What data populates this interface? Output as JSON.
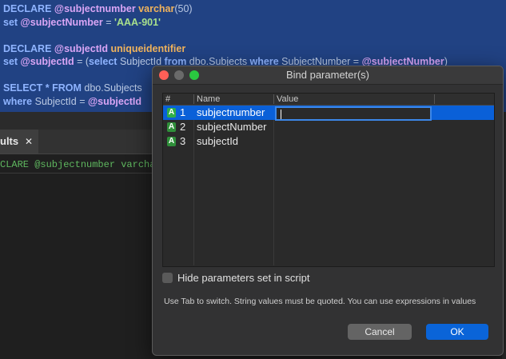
{
  "editor": {
    "lines": [
      {
        "parts": [
          [
            "DECLARE ",
            "kw"
          ],
          [
            "@subjectnumber ",
            "var"
          ],
          [
            "varchar",
            "type"
          ],
          [
            "(50)",
            "plain"
          ]
        ]
      },
      {
        "parts": [
          [
            "set ",
            "kw"
          ],
          [
            "@subjectNumber ",
            "var"
          ],
          [
            "= ",
            "plain"
          ],
          [
            "'AAA-901'",
            "str"
          ]
        ]
      },
      {
        "parts": []
      },
      {
        "parts": [
          [
            "DECLARE ",
            "kw"
          ],
          [
            "@subjectId ",
            "var"
          ],
          [
            "uniqueidentifier",
            "type"
          ]
        ]
      },
      {
        "parts": [
          [
            "set ",
            "kw"
          ],
          [
            "@subjectId ",
            "var"
          ],
          [
            "= (",
            "plain"
          ],
          [
            "select ",
            "kw"
          ],
          [
            "SubjectId ",
            "plain"
          ],
          [
            "from ",
            "kw"
          ],
          [
            "dbo.Subjects ",
            "plain"
          ],
          [
            "where ",
            "kw"
          ],
          [
            "SubjectNumber = ",
            "plain"
          ],
          [
            "@subjectNumber",
            "var"
          ],
          [
            ")",
            "plain"
          ]
        ]
      },
      {
        "parts": []
      },
      {
        "parts": [
          [
            "SELECT * FROM ",
            "kw"
          ],
          [
            "dbo.Subjects",
            "plain"
          ]
        ]
      },
      {
        "parts": [
          [
            "where ",
            "kw"
          ],
          [
            "SubjectId = ",
            "plain"
          ],
          [
            "@subjectId",
            "var"
          ]
        ]
      }
    ]
  },
  "results": {
    "tab_label": "ults",
    "close_glyph": "✕",
    "line_text": "CLARE @subjectnumber varchar"
  },
  "dialog": {
    "title": "Bind parameter(s)",
    "columns": {
      "num": "#",
      "name": "Name",
      "value": "Value"
    },
    "rows": [
      {
        "type_icon": "string-type-icon",
        "badge": "A",
        "num": "1",
        "name": "subjectnumber",
        "value": ""
      },
      {
        "type_icon": "string-type-icon",
        "badge": "A",
        "num": "2",
        "name": "subjectNumber",
        "value": ""
      },
      {
        "type_icon": "string-type-icon",
        "badge": "A",
        "num": "3",
        "name": "subjectId",
        "value": ""
      }
    ],
    "hide_params_label": "Hide parameters set in script",
    "hide_params_checked": false,
    "hint": "Use Tab to switch. String values must be quoted. You can use expressions in values",
    "cancel_label": "Cancel",
    "ok_label": "OK"
  },
  "colors": {
    "editor_selection": "#214283",
    "row_selected": "#0a60d8",
    "ok_button": "#0a64d8",
    "traffic_close": "#fe5f57",
    "traffic_max": "#2ac840"
  }
}
